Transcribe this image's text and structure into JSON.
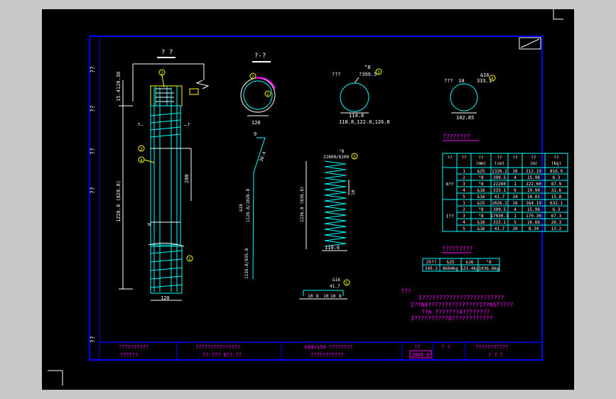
{
  "colors": {
    "frame": "#0000ff",
    "cyan": "#00ffff",
    "white": "#ffffff",
    "yellow": "#ffff00",
    "green": "#00ff00",
    "magenta": "#ff00ff",
    "background": "#000000"
  },
  "side_labels": [
    "??",
    "??",
    "??",
    "??",
    "??"
  ],
  "views": {
    "elevation_title": "? ?",
    "section_title": "?-?",
    "elev_mark_left": "?—",
    "elev_mark_right": "—?",
    "dim_top_left": "15.4120.30",
    "dim_height_left": "1220.8 (820.8)",
    "dim_spacing": "200",
    "dim_width_bottom": "120",
    "section_dim": "120",
    "section_num": "1",
    "ring1_label_a": "???",
    "ring1_label_b": "°8",
    "ring1_label_c": "?399.5",
    "ring1_num": "3",
    "ring1_dim_a": "114.8",
    "ring1_dim_b": "118.8,122.8,126.8",
    "ring2_label_a": "???",
    "ring2_label_b": "&16",
    "ring2_label_c": "333.1",
    "ring2_num": "4",
    "ring2_dim": "102.85",
    "bar_dim_a": "30.4",
    "bar_dim_b": "1126.8/1026.8",
    "bar_dim_c": "1135.8/935.8",
    "bar_label_9": "9",
    "bar_label_916": "&16",
    "spiral_label_a": "°8",
    "spiral_label_b": "22800/8100",
    "spiral_dim_h": "1236.8 (836.8)",
    "spiral_dim_w": "110.6",
    "spiral_pitch": "10",
    "stirrup_label_a": "&16",
    "stirrup_label_b": "41.7",
    "stirrup_num": "5",
    "stirrup_dims": [
      "10",
      "8",
      "10",
      "10",
      "8"
    ]
  },
  "bar_table": {
    "title": "????????",
    "headers": [
      "??",
      "??",
      "??\n(mm)",
      "??\n(cm)",
      "??",
      "??\n(m)",
      "??\n(kg)"
    ],
    "groups": [
      {
        "label": "0??",
        "rows": [
          [
            "1",
            "&25",
            "1326.2",
            "16",
            "212.19",
            "816.9"
          ],
          [
            "2",
            "°8",
            "399.5",
            "4",
            "15.98",
            "6.3"
          ],
          [
            "3",
            "°8",
            "22260",
            "1",
            "222.60",
            "87.9"
          ],
          [
            "4",
            "&16",
            "333.1",
            "6",
            "19.99",
            "31.6"
          ],
          [
            "5",
            "&16",
            "41.7",
            "24",
            "10.01",
            "15.8"
          ]
        ]
      },
      {
        "label": "1??",
        "rows": [
          [
            "1",
            "&25",
            "1026.2",
            "16",
            "164.19",
            "632.1"
          ],
          [
            "2",
            "°8",
            "399.5",
            "4",
            "15.98",
            "6.3"
          ],
          [
            "3",
            "°8",
            "17030.1",
            "1",
            "170.30",
            "67.3"
          ],
          [
            "4",
            "&16",
            "333.1",
            "5",
            "16.66",
            "26.3"
          ],
          [
            "5",
            "&16",
            "41.7",
            "20",
            "8.34",
            "13.2"
          ]
        ]
      }
    ]
  },
  "summary_table": {
    "title": "?????????",
    "row1": [
      "25??",
      "&25",
      "&16",
      "°8"
    ],
    "row2": [
      "145.3",
      "8684kg",
      "521.4kg",
      "1036.8kg"
    ]
  },
  "notes": {
    "title": "???",
    "lines": [
      "1????????????????????????",
      "2??N4???????????????1??N5?????",
      "??m  ???????4????????",
      "3??????????D????????????"
    ]
  },
  "title_block": {
    "cells": [
      "??????????",
      "???????????????",
      "K60+150  ????????",
      "??",
      "? ?",
      "???????????"
    ],
    "cells_lower": [
      "??????",
      "??-??? 6?? ??",
      "???????????",
      "2008.8",
      "",
      "? ? ?"
    ]
  }
}
